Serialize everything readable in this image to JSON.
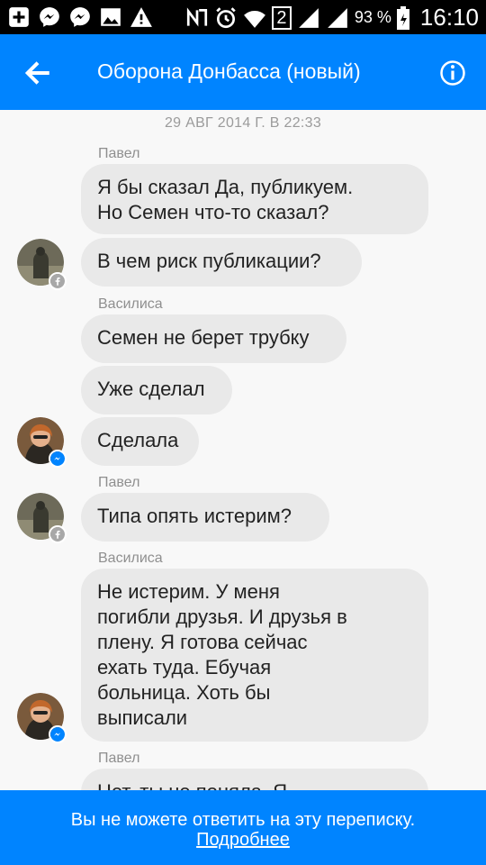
{
  "status_bar": {
    "icons": [
      "plus-box-icon",
      "messenger-icon",
      "messenger-icon",
      "image-icon",
      "warning-icon",
      "nfc-icon",
      "alarm-icon",
      "wifi-icon",
      "sim-2-icon",
      "signal-icon",
      "signal-icon",
      "battery-icon"
    ],
    "sim_label": "2",
    "battery": "93 %",
    "time": "16:10"
  },
  "app_bar": {
    "title": "Оборона Донбасса (новый)",
    "back_icon": "arrow-left-icon",
    "info_icon": "info-icon",
    "color": "#0084ff"
  },
  "conversation": {
    "date_divider": "29 АВГ 2014 Г. В 22:33",
    "groups": [
      {
        "sender": "Павел",
        "badge": "facebook",
        "messages": [
          "Я бы сказал Да, публикуем.\nНо Семен что-то сказал?",
          "В чем риск публикации?"
        ]
      },
      {
        "sender": "Василиса",
        "badge": "messenger",
        "messages": [
          "Семен не берет трубку",
          "Уже сделал",
          "Сделала"
        ]
      },
      {
        "sender": "Павел",
        "badge": "facebook",
        "messages": [
          "Типа опять истерим?"
        ]
      },
      {
        "sender": "Василиса",
        "badge": "messenger",
        "messages": [
          "Не истерим. У меня\nпогибли друзья. И друзья в\nплену. Я готова сейчас\nехать туда. Ебучая\nбольница. Хоть бы\nвыписали"
        ]
      },
      {
        "sender": "Павел",
        "badge": "facebook",
        "messages": [
          "Нет, ты не поняла. Я"
        ]
      }
    ],
    "bubble_color": "#e9e9e9"
  },
  "footer": {
    "message": "Вы не можете ответить на эту переписку.",
    "link": "Подробнее"
  }
}
